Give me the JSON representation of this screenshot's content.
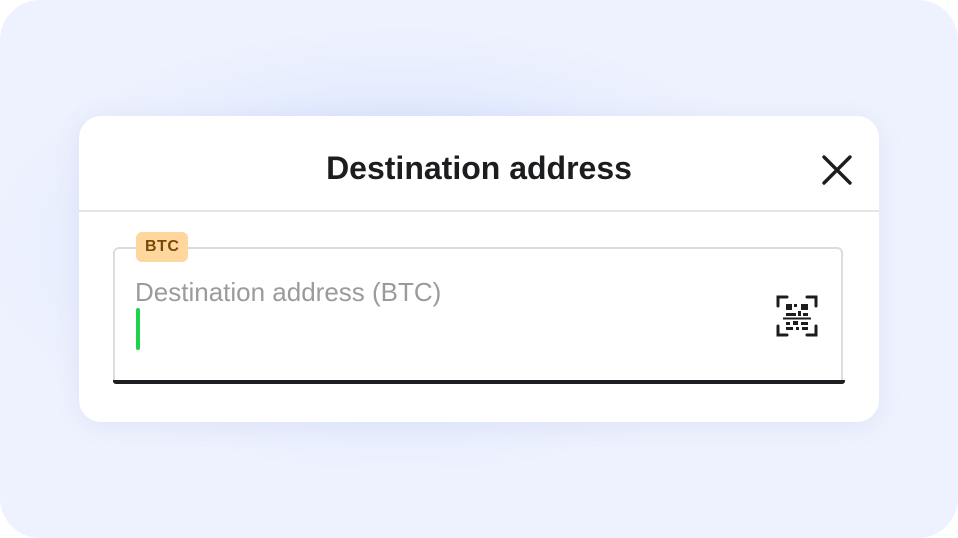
{
  "modal": {
    "title": "Destination address",
    "close_icon": "close-icon"
  },
  "field": {
    "badge": "BTC",
    "placeholder": "Destination address (BTC)",
    "value": "",
    "scan_icon": "qr-scan-icon"
  },
  "colors": {
    "badge_background": "#ffd79e",
    "badge_text": "#7a4a05",
    "caret": "#1ed34a",
    "underline": "#1d1f22"
  }
}
